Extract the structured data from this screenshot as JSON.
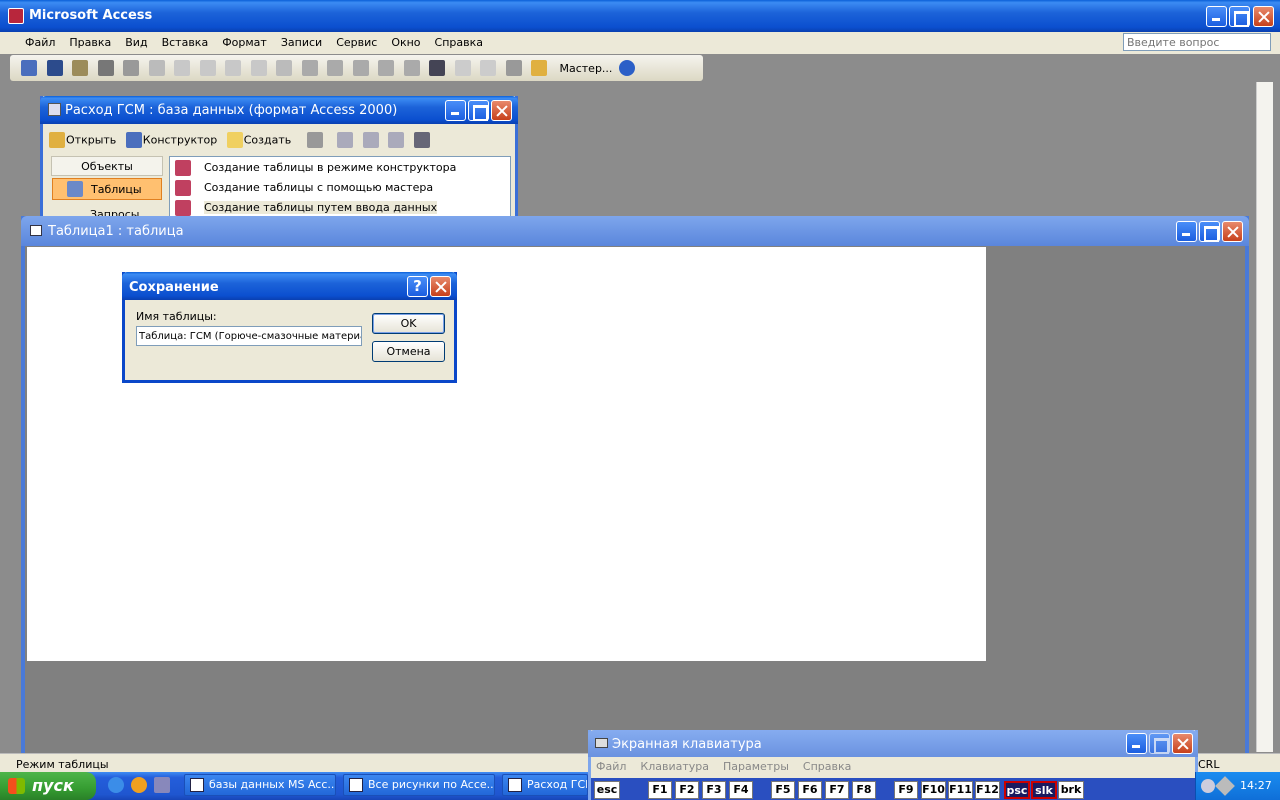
{
  "app": {
    "title": "Microsoft Access",
    "search_placeholder": "Введите вопрос",
    "toolbar_wizard": "Мастер..."
  },
  "menu": [
    "Файл",
    "Правка",
    "Вид",
    "Вставка",
    "Формат",
    "Записи",
    "Сервис",
    "Окно",
    "Справка"
  ],
  "db_window": {
    "title": "Расход ГСМ : база данных (формат Access 2000)",
    "toolbar": [
      "Открыть",
      "Конструктор",
      "Создать"
    ],
    "objects_header": "Объекты",
    "objects": [
      "Таблицы",
      "Запросы"
    ],
    "items": [
      "Создание таблицы в режиме конструктора",
      "Создание таблицы с помощью мастера",
      "Создание таблицы путем ввода данных"
    ]
  },
  "table_window": {
    "title": "Таблица1 : таблица"
  },
  "dialog": {
    "title": "Сохранение",
    "label": "Имя таблицы:",
    "value": "Таблица: ГСМ (Горюче-смазочные материа.",
    "ok": "OK",
    "cancel": "Отмена"
  },
  "status": {
    "left": "Режим таблицы",
    "right": "CRL"
  },
  "osk": {
    "title": "Экранная клавиатура",
    "menu": [
      "Файл",
      "Клавиатура",
      "Параметры",
      "Справка"
    ],
    "keys": [
      "esc",
      "F1",
      "F2",
      "F3",
      "F4",
      "F5",
      "F6",
      "F7",
      "F8",
      "F9",
      "F10",
      "F11",
      "F12",
      "psc",
      "slk",
      "brk"
    ]
  },
  "taskbar": {
    "start": "пуск",
    "items": [
      "базы данных MS Acc...",
      "Все рисунки по Acce...",
      "Расход ГСМ"
    ],
    "clock": "14:27"
  }
}
